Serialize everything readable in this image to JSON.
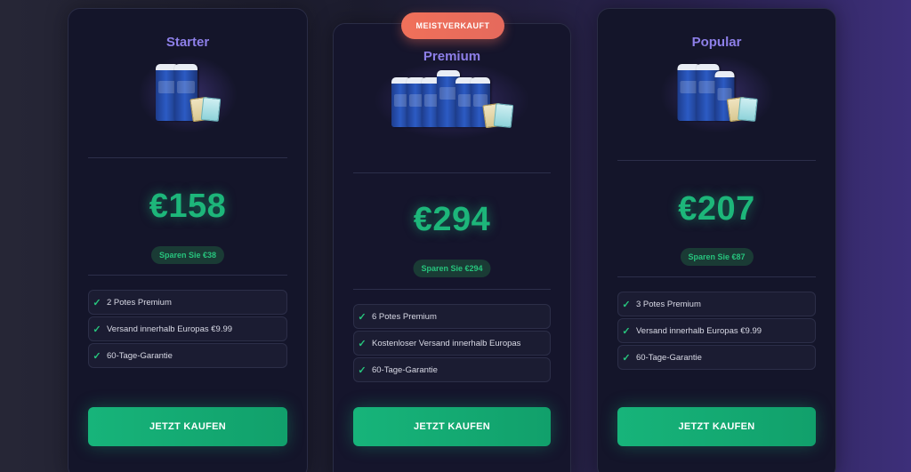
{
  "badge": "MEISTVERKAUFT",
  "icons": {
    "check": "check-icon"
  },
  "colors": {
    "accent": "#1db67a",
    "tier": "#8d7fe8",
    "badge": "#f0705a"
  },
  "plans": [
    {
      "name": "Starter",
      "price": "€158",
      "save": "Sparen Sie €38",
      "features": [
        "2 Potes Premium",
        "Versand innerhalb Europas €9.99",
        "60-Tage-Garantie"
      ],
      "cta": "JETZT KAUFEN"
    },
    {
      "name": "Premium",
      "price": "€294",
      "save": "Sparen Sie €294",
      "features": [
        "6 Potes Premium",
        "Kostenloser Versand innerhalb Europas",
        "60-Tage-Garantie"
      ],
      "cta": "JETZT KAUFEN"
    },
    {
      "name": "Popular",
      "price": "€207",
      "save": "Sparen Sie €87",
      "features": [
        "3 Potes Premium",
        "Versand innerhalb Europas €9.99",
        "60-Tage-Garantie"
      ],
      "cta": "JETZT KAUFEN"
    }
  ]
}
